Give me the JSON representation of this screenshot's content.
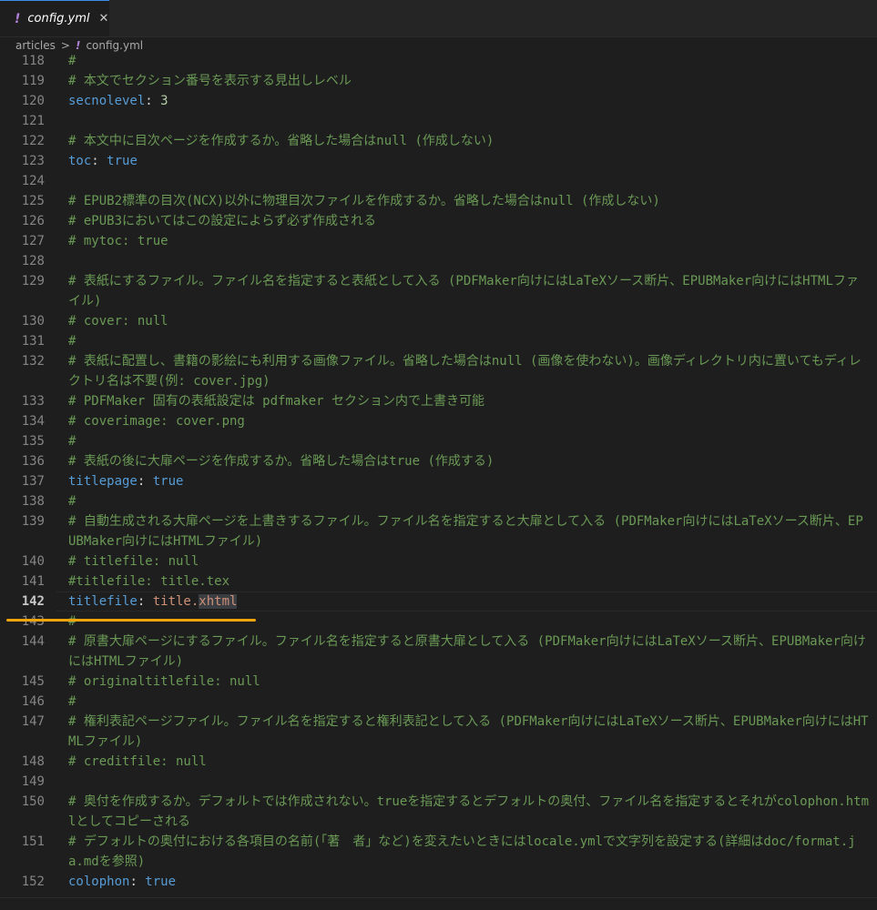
{
  "tab": {
    "icon": "!",
    "label": "config.yml",
    "close": "✕"
  },
  "breadcrumb": {
    "folder": "articles",
    "sep": ">",
    "file_icon": "!",
    "file": "config.yml"
  },
  "lines": [
    {
      "n": "118",
      "segments": [
        {
          "c": "comment",
          "t": "#"
        }
      ]
    },
    {
      "n": "119",
      "segments": [
        {
          "c": "comment",
          "t": "# 本文でセクション番号を表示する見出しレベル"
        }
      ]
    },
    {
      "n": "120",
      "segments": [
        {
          "c": "key",
          "t": "secnolevel"
        },
        {
          "c": "colon",
          "t": ": "
        },
        {
          "c": "num",
          "t": "3"
        }
      ]
    },
    {
      "n": "121",
      "segments": []
    },
    {
      "n": "122",
      "segments": [
        {
          "c": "comment",
          "t": "# 本文中に目次ページを作成するか。省略した場合はnull (作成しない)"
        }
      ]
    },
    {
      "n": "123",
      "segments": [
        {
          "c": "key",
          "t": "toc"
        },
        {
          "c": "colon",
          "t": ": "
        },
        {
          "c": "bool",
          "t": "true"
        }
      ]
    },
    {
      "n": "124",
      "segments": []
    },
    {
      "n": "125",
      "segments": [
        {
          "c": "comment",
          "t": "# EPUB2標準の目次(NCX)以外に物理目次ファイルを作成するか。省略した場合はnull (作成しない)"
        }
      ]
    },
    {
      "n": "126",
      "segments": [
        {
          "c": "comment",
          "t": "# ePUB3においてはこの設定によらず必ず作成される"
        }
      ]
    },
    {
      "n": "127",
      "segments": [
        {
          "c": "comment",
          "t": "# mytoc: true"
        }
      ]
    },
    {
      "n": "128",
      "segments": []
    },
    {
      "n": "129",
      "tall": true,
      "segments": [
        {
          "c": "comment",
          "t": "# 表紙にするファイル。ファイル名を指定すると表紙として入る (PDFMaker向けにはLaTeXソース断片、EPUBMaker向けにはHTMLファイル)"
        }
      ]
    },
    {
      "n": "130",
      "segments": [
        {
          "c": "comment",
          "t": "# cover: null"
        }
      ]
    },
    {
      "n": "131",
      "segments": [
        {
          "c": "comment",
          "t": "#"
        }
      ]
    },
    {
      "n": "132",
      "tall": true,
      "segments": [
        {
          "c": "comment",
          "t": "# 表紙に配置し、書籍の影絵にも利用する画像ファイル。省略した場合はnull (画像を使わない)。画像ディレクトリ内に置いてもディレクトリ名は不要(例: cover.jpg)"
        }
      ]
    },
    {
      "n": "133",
      "segments": [
        {
          "c": "comment",
          "t": "# PDFMaker 固有の表紙設定は pdfmaker セクション内で上書き可能"
        }
      ]
    },
    {
      "n": "134",
      "segments": [
        {
          "c": "comment",
          "t": "# coverimage: cover.png"
        }
      ]
    },
    {
      "n": "135",
      "segments": [
        {
          "c": "comment",
          "t": "#"
        }
      ]
    },
    {
      "n": "136",
      "segments": [
        {
          "c": "comment",
          "t": "# 表紙の後に大扉ページを作成するか。省略した場合はtrue (作成する)"
        }
      ]
    },
    {
      "n": "137",
      "segments": [
        {
          "c": "key",
          "t": "titlepage"
        },
        {
          "c": "colon",
          "t": ": "
        },
        {
          "c": "bool",
          "t": "true"
        }
      ]
    },
    {
      "n": "138",
      "segments": [
        {
          "c": "comment",
          "t": "#"
        }
      ]
    },
    {
      "n": "139",
      "tall": true,
      "segments": [
        {
          "c": "comment",
          "t": "# 自動生成される大扉ページを上書きするファイル。ファイル名を指定すると大扉として入る (PDFMaker向けにはLaTeXソース断片、EPUBMaker向けにはHTMLファイル)"
        }
      ]
    },
    {
      "n": "140",
      "segments": [
        {
          "c": "comment",
          "t": "# titlefile: null"
        }
      ]
    },
    {
      "n": "141",
      "segments": [
        {
          "c": "comment",
          "t": "#titlefile: title.tex"
        }
      ]
    },
    {
      "n": "142",
      "current": true,
      "segments": [
        {
          "c": "key",
          "t": "titlefile"
        },
        {
          "c": "colon",
          "t": ": "
        },
        {
          "c": "str",
          "t": "title."
        },
        {
          "c": "str sel",
          "t": "xhtml"
        }
      ]
    },
    {
      "n": "143",
      "segments": [
        {
          "c": "comment",
          "t": "#"
        }
      ]
    },
    {
      "n": "144",
      "tall": true,
      "segments": [
        {
          "c": "comment",
          "t": "# 原書大扉ページにするファイル。ファイル名を指定すると原書大扉として入る (PDFMaker向けにはLaTeXソース断片、EPUBMaker向けにはHTMLファイル)"
        }
      ]
    },
    {
      "n": "145",
      "segments": [
        {
          "c": "comment",
          "t": "# originaltitlefile: null"
        }
      ]
    },
    {
      "n": "146",
      "segments": [
        {
          "c": "comment",
          "t": "#"
        }
      ]
    },
    {
      "n": "147",
      "tall": true,
      "segments": [
        {
          "c": "comment",
          "t": "# 権利表記ページファイル。ファイル名を指定すると権利表記として入る (PDFMaker向けにはLaTeXソース断片、EPUBMaker向けにはHTMLファイル)"
        }
      ]
    },
    {
      "n": "148",
      "segments": [
        {
          "c": "comment",
          "t": "# creditfile: null"
        }
      ]
    },
    {
      "n": "149",
      "segments": []
    },
    {
      "n": "150",
      "tall": true,
      "segments": [
        {
          "c": "comment",
          "t": "# 奥付を作成するか。デフォルトでは作成されない。trueを指定するとデフォルトの奥付、ファイル名を指定するとそれがcolophon.htmlとしてコピーされる"
        }
      ]
    },
    {
      "n": "151",
      "tall": true,
      "segments": [
        {
          "c": "comment",
          "t": "# デフォルトの奥付における各項目の名前(「著　者」など)を変えたいときにはlocale.ymlで文字列を設定する(詳細はdoc/format.ja.mdを参照)"
        }
      ]
    },
    {
      "n": "152",
      "segments": [
        {
          "c": "key",
          "t": "colophon"
        },
        {
          "c": "colon",
          "t": ": "
        },
        {
          "c": "bool",
          "t": "true"
        }
      ]
    }
  ]
}
